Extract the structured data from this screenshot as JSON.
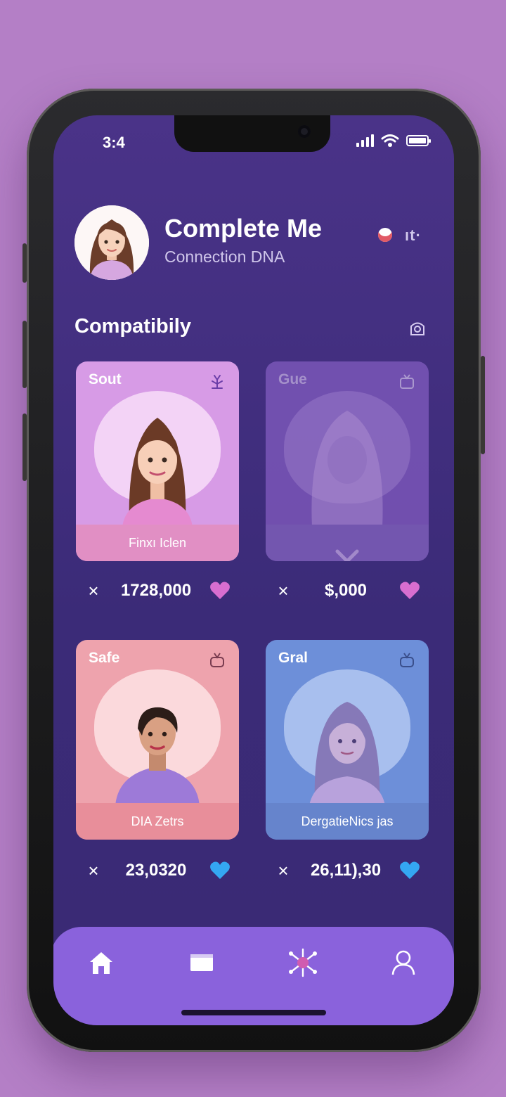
{
  "status": {
    "time": "3:4"
  },
  "header": {
    "title": "Complete Me",
    "subtitle": "Connection DNA",
    "more_icon": "⁝"
  },
  "section": {
    "title": "Compatibily"
  },
  "cards": [
    {
      "name": "Sout",
      "caption": "Finxı Iclen",
      "value": "1728,000",
      "heart_color": "#d86ed0",
      "bg": "#d79be6",
      "blob": "#f3d3f6",
      "bar": "#e18fc4"
    },
    {
      "name": "Gue",
      "caption": "",
      "value": "$,000",
      "heart_color": "#d86ed0",
      "bg": "#7a56b8",
      "blob": "#9a77cc",
      "bar": "#7d5eb9"
    },
    {
      "name": "Safe",
      "caption": "DIA Zetrs",
      "value": "23,0320",
      "heart_color": "#34a7f2",
      "bg": "#eea3ad",
      "blob": "#fbd9dc",
      "bar": "#e88e9a"
    },
    {
      "name": "Gral",
      "caption": "DergatieNics jas",
      "value": "26,11),30",
      "heart_color": "#34a7f2",
      "bg": "#6d8fd9",
      "blob": "#a8bfee",
      "bar": "#6684cc"
    }
  ],
  "nav": [
    "home-icon",
    "cards-icon",
    "dna-network-icon",
    "profile-icon"
  ]
}
